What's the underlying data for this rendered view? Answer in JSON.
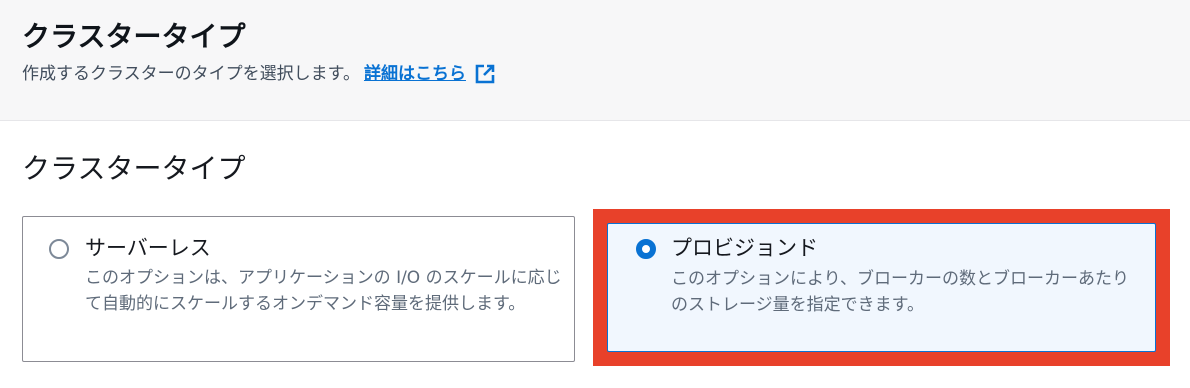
{
  "header": {
    "title": "クラスタータイプ",
    "description": "作成するクラスターのタイプを選択します。",
    "learn_more": "詳細はこちら"
  },
  "section": {
    "title": "クラスタータイプ"
  },
  "options": [
    {
      "label": "サーバーレス",
      "description": "このオプションは、アプリケーションの I/O のスケールに応じて自動的にスケールするオンデマンド容量を提供します。",
      "selected": false
    },
    {
      "label": "プロビジョンド",
      "description": "このオプションにより、ブローカーの数とブローカーあたりのストレージ量を指定できます。",
      "selected": true
    }
  ],
  "colors": {
    "accent": "#0972d3",
    "highlight": "#e8412a"
  }
}
